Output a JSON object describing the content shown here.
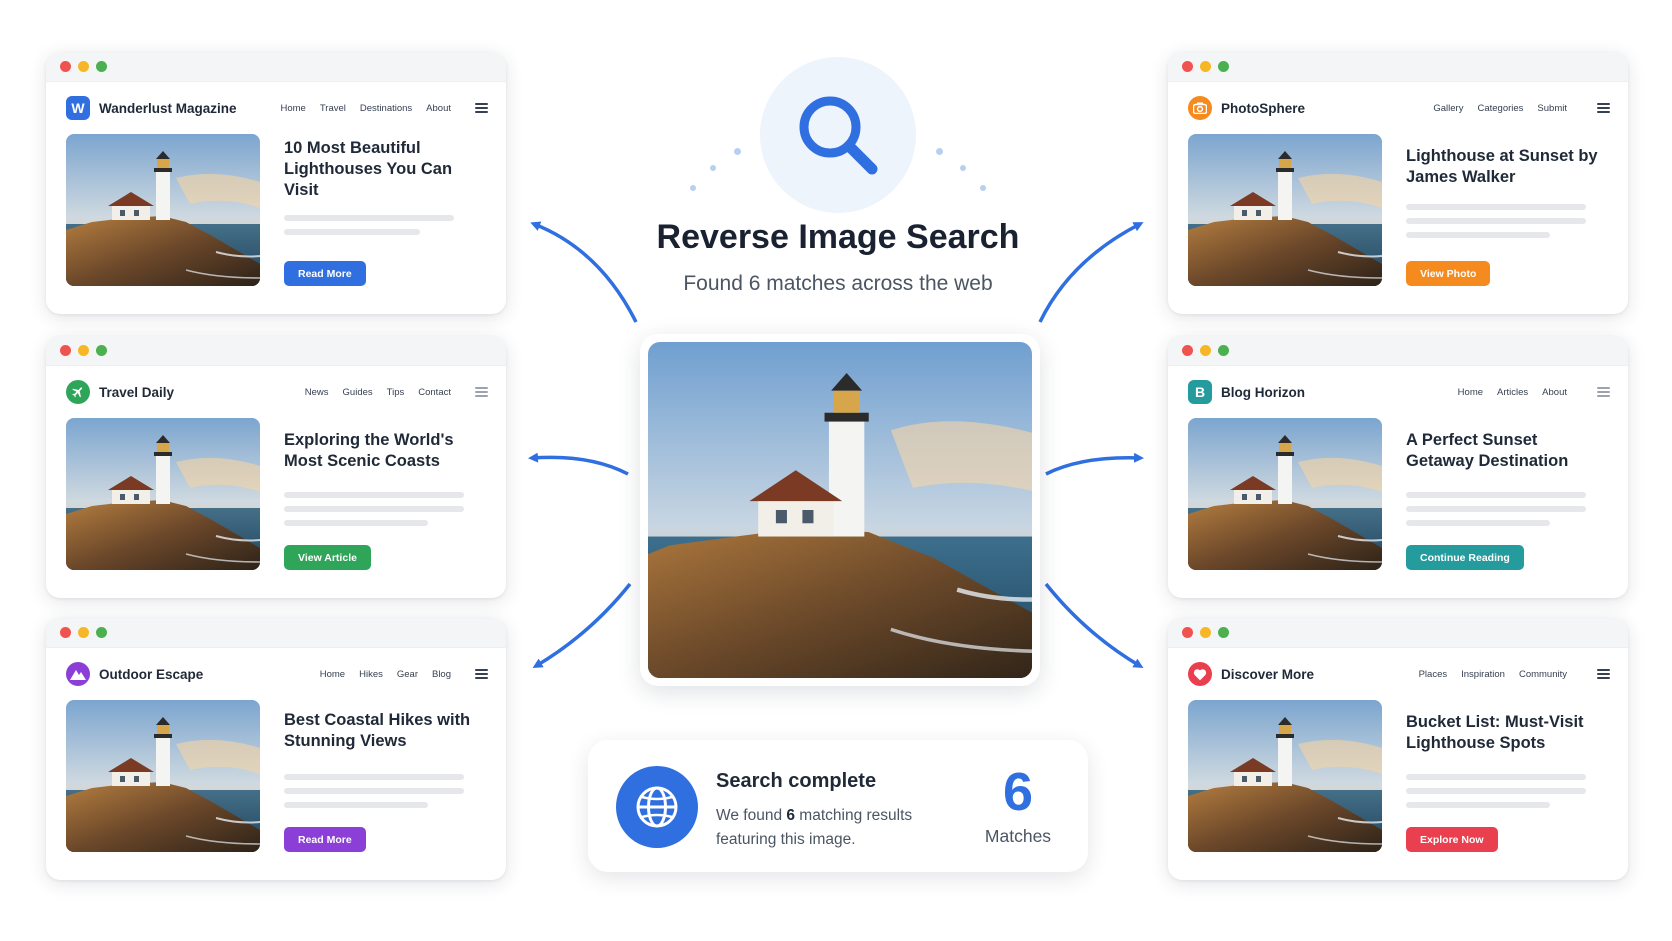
{
  "header": {
    "title": "Reverse Image Search",
    "subtitle": "Found 6 matches across the web"
  },
  "colors": {
    "accent": "#2f6fe0",
    "blue": "#2f6fe0",
    "orange": "#f58a1f",
    "green": "#2fa55a",
    "teal": "#249b9d",
    "purple": "#8b3fd6",
    "red": "#ea3f4e"
  },
  "cards": [
    {
      "logo_letter": "W",
      "logo_icon": "w-letter-icon",
      "site": "Wanderlust Magazine",
      "nav": [
        "Home",
        "Travel",
        "Destinations",
        "About"
      ],
      "headline": "10 Most Beautiful Lighthouses You Can Visit",
      "button": "Read More"
    },
    {
      "logo_letter": "",
      "logo_icon": "airplane-icon",
      "site": "Travel Daily",
      "nav": [
        "News",
        "Guides",
        "Tips",
        "Contact"
      ],
      "headline": "Exploring the World's Most Scenic Coasts",
      "button": "View Article"
    },
    {
      "logo_letter": "",
      "logo_icon": "mountain-icon",
      "site": "Outdoor Escape",
      "nav": [
        "Home",
        "Hikes",
        "Gear",
        "Blog"
      ],
      "headline": "Best Coastal Hikes with Stunning Views",
      "button": "Read More"
    },
    {
      "logo_letter": "",
      "logo_icon": "camera-icon",
      "site": "PhotoSphere",
      "nav": [
        "Gallery",
        "Categories",
        "Submit"
      ],
      "headline": "Lighthouse at Sunset by James Walker",
      "button": "View Photo"
    },
    {
      "logo_letter": "B",
      "logo_icon": "b-letter-icon",
      "site": "Blog Horizon",
      "nav": [
        "Home",
        "Articles",
        "About"
      ],
      "headline": "A Perfect Sunset Getaway Destination",
      "button": "Continue Reading"
    },
    {
      "logo_letter": "",
      "logo_icon": "heart-icon",
      "site": "Discover More",
      "nav": [
        "Places",
        "Inspiration",
        "Community"
      ],
      "headline": "Bucket List: Must-Visit Lighthouse Spots",
      "button": "Explore Now"
    }
  ],
  "status": {
    "title": "Search complete",
    "text_before": "We found ",
    "count_inline": "6",
    "text_after": " matching results featuring this image.",
    "count": "6",
    "count_label": "Matches"
  }
}
